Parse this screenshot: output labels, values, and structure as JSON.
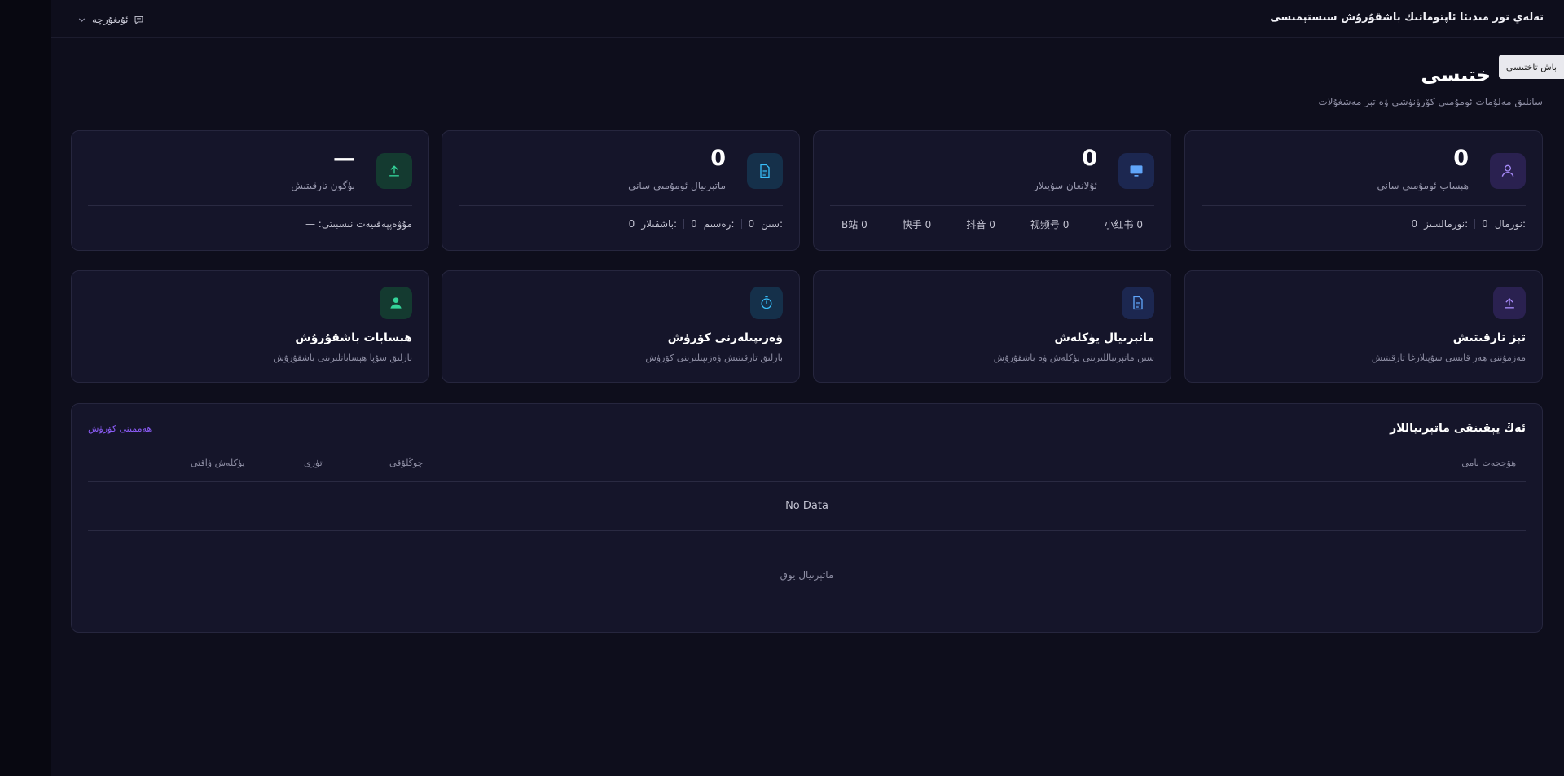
{
  "header": {
    "app_title": "تەلەي تور مىدىئا ئاپتوماتىك باشقۇرۇش سىستېمىسى",
    "language_label": "ئۇيغۇرچە"
  },
  "tooltip": "باش تاختىسى",
  "page": {
    "title": "ختىسى",
    "subtitle": "سانلىق مەلۇمات ئومۇمىي كۆرۈنۈشى ۋە تېز مەشغۇلات"
  },
  "stats": [
    {
      "label": "ھېساب ئومۇمىي سانى",
      "value": "0",
      "icon": "user-icon",
      "footer": [
        {
          "label": "نورمال:",
          "value": "0"
        },
        {
          "label": "نورمالسىز:",
          "value": "0"
        }
      ]
    },
    {
      "label": "ئۇلانغان سۇپىلار",
      "value": "0",
      "icon": "monitor-icon",
      "platforms": [
        {
          "name": "小红书",
          "count": "0"
        },
        {
          "name": "视频号",
          "count": "0"
        },
        {
          "name": "抖音",
          "count": "0"
        },
        {
          "name": "快手",
          "count": "0"
        },
        {
          "name": "B站",
          "count": "0"
        }
      ]
    },
    {
      "label": "ماتېرىيال ئومۇمىي سانى",
      "value": "0",
      "icon": "document-icon",
      "footer": [
        {
          "label": "سىن:",
          "value": "0"
        },
        {
          "label": "رەسىم:",
          "value": "0"
        },
        {
          "label": "باشقىلار:",
          "value": "0"
        }
      ]
    },
    {
      "label": "بۈگۈن تارقىتىش",
      "value": "—",
      "icon": "upload-icon",
      "footer_text": "مۇۋەپپەقىيەت نىسبىتى: —"
    }
  ],
  "quick_actions": [
    {
      "title": "تېز تارقىتىش",
      "desc": "مەزمۇننى ھەر قايسى سۇپىلارغا تارقىتىش",
      "icon": "upload-icon"
    },
    {
      "title": "ماتېرىيال يۈكلەش",
      "desc": "سىن ماتېرىياللىرىنى يۈكلەش ۋە باشقۇرۇش",
      "icon": "document-icon"
    },
    {
      "title": "ۋەزىپىلەرنى كۆرۈش",
      "desc": "بارلىق تارقىتىش ۋەزىپىلىرىنى كۆرۈش",
      "icon": "timer-icon"
    },
    {
      "title": "ھېسابات باشقۇرۇش",
      "desc": "بارلىق سۇپا ھېساباتلىرىنى باشقۇرۇش",
      "icon": "person-icon"
    }
  ],
  "recent": {
    "title": "ئەڭ يېقىنقى ماتېرىياللار",
    "view_all": "ھەممىنى كۆرۈش",
    "columns": {
      "name": "ھۆججەت نامى",
      "status": "چوڭلۇقى",
      "type": "تۈرى",
      "time": "يۈكلەش ۋاقتى"
    },
    "no_data": "No Data",
    "empty": "ماتېرىيال يوق"
  },
  "colors": {
    "accent": "#8b5cf6",
    "user_bg": "#2a2150",
    "user_fg": "#a78bfa",
    "monitor_bg": "#1c2750",
    "monitor_fg": "#60a5fa",
    "doc_bg": "#15304a",
    "doc_fg": "#38bdf8",
    "upload_bg": "#143a30",
    "upload_fg": "#34d399"
  }
}
